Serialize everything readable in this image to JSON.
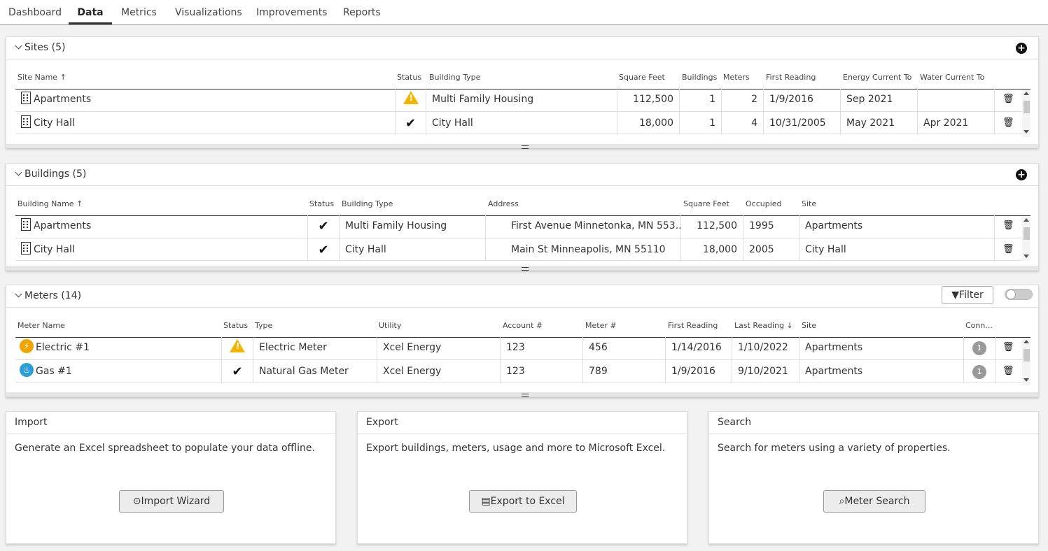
{
  "nav": {
    "tabs": [
      "Dashboard",
      "Data",
      "Metrics",
      "Visualizations",
      "Improvements",
      "Reports"
    ],
    "active": "Data"
  },
  "sites": {
    "title": "Sites (5)",
    "columns": [
      "Site Name ↑",
      "Status",
      "Building Type",
      "Square Feet",
      "Buildings",
      "Meters",
      "First Reading",
      "Energy Current To",
      "Water Current To"
    ],
    "rows": [
      {
        "name": "Apartments",
        "status": "warning",
        "type": "Multi Family Housing",
        "sqft": "112,500",
        "buildings": "1",
        "meters": "2",
        "first": "1/9/2016",
        "energy": "Sep 2021",
        "water": ""
      },
      {
        "name": "City Hall",
        "status": "ok",
        "type": "City Hall",
        "sqft": "18,000",
        "buildings": "1",
        "meters": "4",
        "first": "10/31/2005",
        "energy": "May 2021",
        "water": "Apr 2021"
      }
    ]
  },
  "buildings": {
    "title": "Buildings (5)",
    "columns": [
      "Building Name ↑",
      "Status",
      "Building Type",
      "Address",
      "Square Feet",
      "Occupied",
      "Site"
    ],
    "rows": [
      {
        "name": "Apartments",
        "status": "ok",
        "type": "Multi Family Housing",
        "address": "First Avenue Minnetonka, MN 553...",
        "sqft": "112,500",
        "occupied": "1995",
        "site": "Apartments"
      },
      {
        "name": "City Hall",
        "status": "ok",
        "type": "City Hall",
        "address": "Main St Minneapolis, MN 55110",
        "sqft": "18,000",
        "occupied": "2005",
        "site": "City Hall"
      }
    ]
  },
  "meters": {
    "title": "Meters (14)",
    "filter_label": "Filter",
    "columns": [
      "Meter Name",
      "Status",
      "Type",
      "Utility",
      "Account #",
      "Meter #",
      "First Reading",
      "Last Reading ↓",
      "Site",
      "Conn..."
    ],
    "rows": [
      {
        "name": "Electric #1",
        "icon": "electric-icon",
        "status": "warning",
        "type": "Electric Meter",
        "utility": "Xcel Energy",
        "account": "123",
        "meter": "456",
        "first": "1/14/2016",
        "last": "1/10/2022",
        "site": "Apartments",
        "conn": "1"
      },
      {
        "name": "Gas #1",
        "icon": "gas-icon",
        "status": "ok",
        "type": "Natural Gas Meter",
        "utility": "Xcel Energy",
        "account": "123",
        "meter": "789",
        "first": "1/9/2016",
        "last": "9/10/2021",
        "site": "Apartments",
        "conn": "1"
      }
    ]
  },
  "cards": {
    "import": {
      "title": "Import",
      "desc": "Generate an Excel spreadsheet to populate your data offline.",
      "button": "Import Wizard"
    },
    "export": {
      "title": "Export",
      "desc": "Export buildings, meters, usage and more to Microsoft Excel.",
      "button": "Export to Excel"
    },
    "search": {
      "title": "Search",
      "desc": "Search for meters using a variety of properties.",
      "button": "Meter Search"
    }
  },
  "colors": {
    "warning": "#f5b400",
    "electric": "#f0a500",
    "gas": "#2a9fd6"
  }
}
